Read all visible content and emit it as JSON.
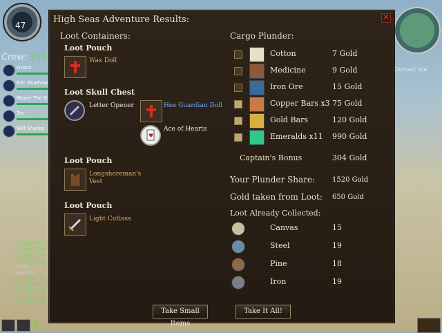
{
  "panel": {
    "title": "High Seas Adventure Results:",
    "loot_containers_label": "Loot Containers:",
    "cargo_plunder_label": "Cargo Plunder:"
  },
  "containers": [
    {
      "name": "Loot Pouch",
      "items": [
        {
          "label": "Wax Doll",
          "color": "#d7b160",
          "icon": "wax-doll-icon"
        }
      ]
    },
    {
      "name": "Loot Skull Chest",
      "items": [
        {
          "label": "Letter Opener",
          "color": "#f0ead6",
          "icon": "letter-opener-icon"
        },
        {
          "label": "Hex Guardian Doll",
          "color": "#6fa8ff",
          "icon": "hex-guardian-doll-icon"
        },
        {
          "label": "Ace of Hearts",
          "color": "#f0ead6",
          "icon": "ace-of-hearts-icon"
        }
      ]
    },
    {
      "name": "Loot Pouch",
      "items": [
        {
          "label": "Longshoreman's Vest",
          "color": "#d7b160",
          "icon": "vest-icon"
        }
      ]
    },
    {
      "name": "Loot Pouch",
      "items": [
        {
          "label": "Light Cutlass",
          "color": "#d7b160",
          "icon": "cutlass-icon"
        }
      ]
    }
  ],
  "cargo": [
    {
      "name": "Cotton",
      "value": "7 Gold",
      "checked": false,
      "icon": "cotton-icon",
      "color": "#e6e0c8"
    },
    {
      "name": "Medicine",
      "value": "9 Gold",
      "checked": false,
      "icon": "medicine-icon",
      "color": "#8a5a3a"
    },
    {
      "name": "Iron Ore",
      "value": "15 Gold",
      "checked": false,
      "icon": "iron-ore-icon",
      "color": "#3a6a9a"
    },
    {
      "name": "Copper Bars x3",
      "value": "75 Gold",
      "checked": true,
      "icon": "copper-bars-icon",
      "color": "#c77a4a"
    },
    {
      "name": "Gold Bars",
      "value": "120 Gold",
      "checked": true,
      "icon": "gold-bars-icon",
      "color": "#d9b040"
    },
    {
      "name": "Emeralds x11",
      "value": "990 Gold",
      "checked": true,
      "icon": "emeralds-icon",
      "color": "#2fc88a"
    }
  ],
  "captains_bonus": {
    "label": "Captain's Bonus",
    "value": "304 Gold"
  },
  "plunder_share": {
    "label": "Your Plunder Share:",
    "value": "1520 Gold"
  },
  "gold_from_loot": {
    "label": "Gold taken from Loot:",
    "value": "650 Gold"
  },
  "loot_collected": {
    "label": "Loot Already Collected:",
    "items": [
      {
        "name": "Canvas",
        "value": "15",
        "icon": "canvas-icon",
        "color": "#c9bfa0"
      },
      {
        "name": "Steel",
        "value": "19",
        "icon": "steel-icon",
        "color": "#6f8aa8"
      },
      {
        "name": "Pine",
        "value": "18",
        "icon": "pine-icon",
        "color": "#8a6a48"
      },
      {
        "name": "Iron",
        "value": "19",
        "icon": "iron-icon",
        "color": "#7a7f8a"
      }
    ]
  },
  "buttons": {
    "take_small": "Take Small Items",
    "take_all": "Take It All!"
  },
  "hud": {
    "level": "47",
    "crew_label": "Crew:",
    "crew_percent": "35%",
    "minimap_label": "Outcast Isle",
    "crew_members": [
      "Drizzy",
      "Eric Bluehaw",
      "Moyer The D",
      "Tre'",
      "Will Sharksi"
    ],
    "chat_lines": [
      "[Crew] Eric Bl",
      "[Crew] Sylar",
      "[Crew] Sylar",
      "[Crew] Drizzy",
      "Sylar: Rammin",
      "[Crew] Drizzy",
      "[Crew] Eric Bl",
      "[Crew] Drizzy",
      "[Crew] Drizzy",
      "[Crew] Drizzy"
    ]
  }
}
